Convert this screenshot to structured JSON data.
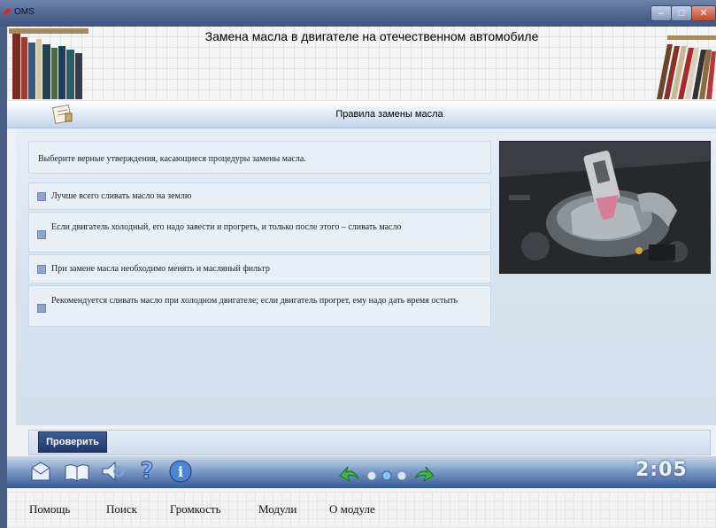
{
  "window": {
    "title": "OMS"
  },
  "header": {
    "title": "Замена масла в двигателе на отечественном автомобиле"
  },
  "section": {
    "title": "Правила замены масла"
  },
  "question": {
    "text": "Выберите верные утверждения, касающиеся процедуры замены масла."
  },
  "options": [
    {
      "text": "Лучше всего сливать масло на землю",
      "checked": false
    },
    {
      "text": "Если двигатель холодный, его надо завести и прогреть, и только после этого – сливать масло",
      "checked": false
    },
    {
      "text": "При замене масла необходимо менять и масляный фильтр",
      "checked": false
    },
    {
      "text": "Рекомендуется сливать масло при холодном двигателе; если двигатель прогрет, ему надо дать время остыть",
      "checked": false
    }
  ],
  "actions": {
    "check_label": "Проверить"
  },
  "toolbar": {
    "icons": [
      "mail-icon",
      "book-icon",
      "speaker-icon",
      "help-icon",
      "info-icon"
    ],
    "nav": [
      "back-arrow-icon",
      "page-dots",
      "forward-arrow-icon"
    ],
    "timer": "2:05"
  },
  "menu": {
    "help": "Помощь",
    "search": "Поиск",
    "volume": "Громкость",
    "modules": "Модули",
    "about": "О модуле"
  },
  "colors": {
    "accent": "#2a4580",
    "toolbar_top": "#c7d6ea",
    "toolbar_bottom": "#375a95",
    "content_bg": "#dbe6f1"
  }
}
